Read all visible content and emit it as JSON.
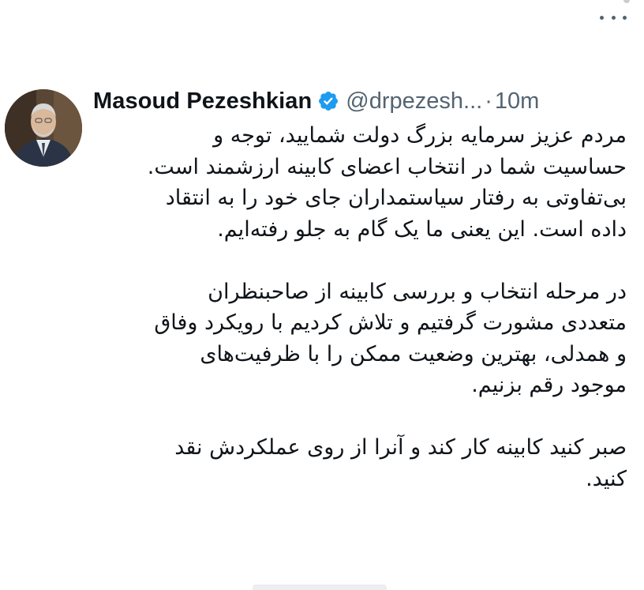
{
  "tweet": {
    "author_name": "Masoud Pezeshkian",
    "handle": "@drpezesh...",
    "separator": "·",
    "time": "10m",
    "body_paragraphs": [
      [
        "مردم عزیز سرمایه بزرگ دولت شمایید، توجه و",
        "حساسیت شما در انتخاب اعضای کابینه ارزشمند است.",
        "بی‌تفاوتی به رفتار سیاستمداران جای خود را به انتقاد",
        "داده است. این یعنی ما یک گام به جلو رفته‌ایم."
      ],
      [
        "در مرحله انتخاب و بررسی کابینه از صاحبنظران",
        "متعددی مشورت گرفتیم و تلاش کردیم با رویکرد وفاق",
        "و همدلی، بهترین وضعیت ممکن را با ظرفیت‌های",
        "موجود رقم بزنیم."
      ],
      [
        "صبر کنید کابینه کار کند و آنرا از روی عملکردش نقد",
        "کنید."
      ]
    ]
  },
  "icons": {
    "verified": "verified-badge-icon",
    "more": "more-options-icon"
  },
  "colors": {
    "text": "#0f1419",
    "secondary": "#536471",
    "verified": "#1d9bf0"
  }
}
